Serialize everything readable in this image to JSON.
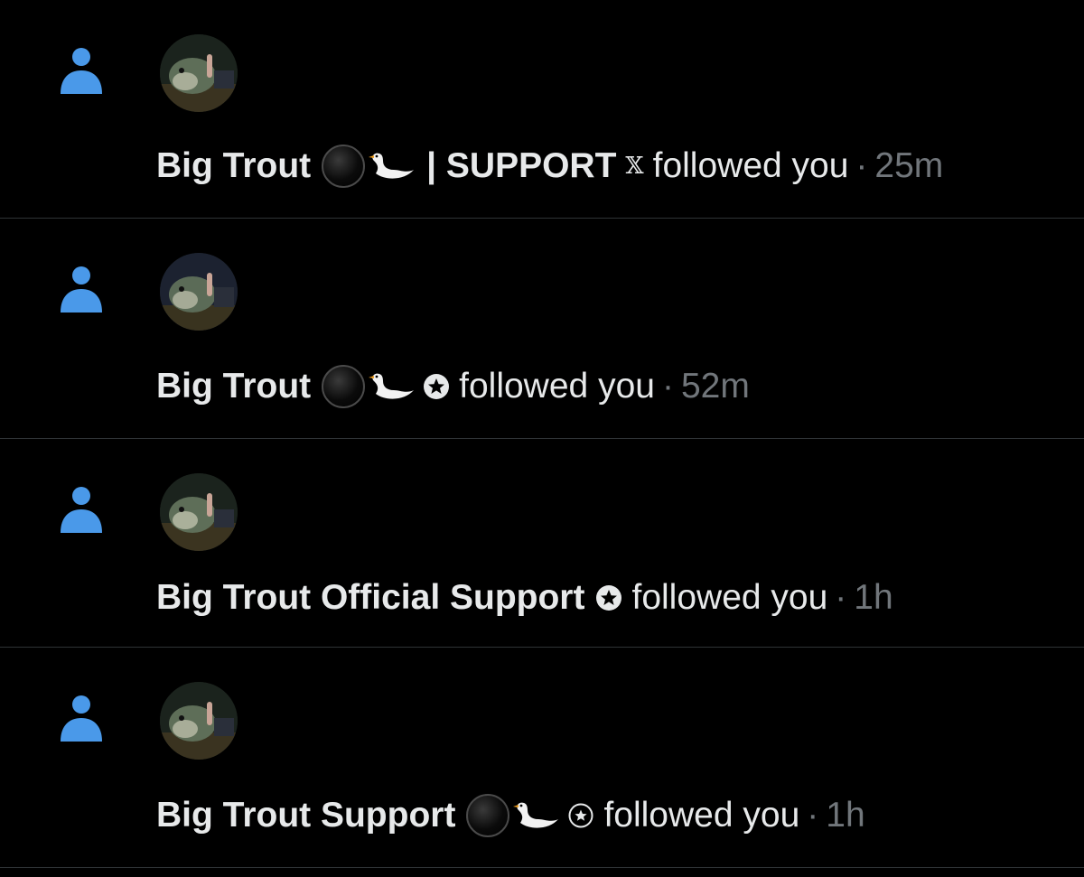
{
  "notifications": [
    {
      "name": "Big Trout",
      "emoji_circle": true,
      "swan": true,
      "suffix": "| SUPPORT",
      "badge_icon": "x-logo-icon",
      "badge_glyph": "𝕏",
      "action": "followed you",
      "separator": "·",
      "time": "25m"
    },
    {
      "name": "Big Trout",
      "emoji_circle": true,
      "swan": true,
      "suffix": "",
      "badge_icon": "star-circle-icon",
      "action": "followed you",
      "separator": "·",
      "time": "52m"
    },
    {
      "name": "Big Trout Official Support",
      "emoji_circle": false,
      "swan": false,
      "suffix": "",
      "badge_icon": "star-circle-icon",
      "action": "followed you",
      "separator": "·",
      "time": "1h"
    },
    {
      "name": "Big Trout Support",
      "emoji_circle": true,
      "swan": true,
      "suffix": "",
      "badge_icon": "star-ring-icon",
      "action": "followed you",
      "separator": "·",
      "time": "1h"
    }
  ],
  "colors": {
    "background": "#000000",
    "person_icon": "#4a99e9",
    "divider": "#2f3336",
    "primary_text": "#e7e9ea",
    "secondary_text": "#71767b"
  },
  "icons": {
    "follow": "person-icon",
    "black_circle": "black-circle-emoji-icon",
    "swan": "swan-emoji-icon"
  }
}
